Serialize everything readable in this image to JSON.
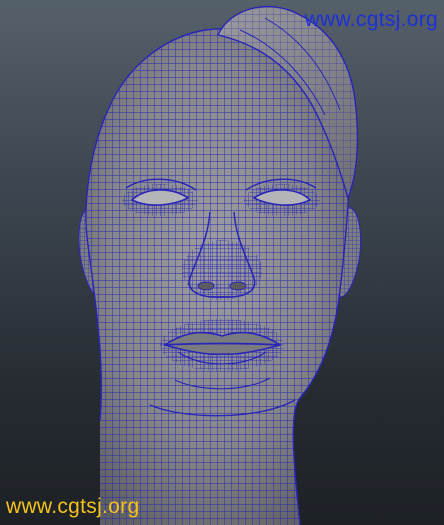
{
  "viewport": {
    "background_top": "#55606a",
    "background_bottom": "#1d2126",
    "model": {
      "subject": "head",
      "shading_color": "#8a8b8d",
      "wireframe_color": "#2a24b8",
      "hair_color": "#8f9093"
    }
  },
  "watermark_top": {
    "text": "www.cgtsj.org",
    "color": "#1f2fd8"
  },
  "watermark_bottom": {
    "text": "www.cgtsj.org",
    "color": "#f4c21a"
  }
}
